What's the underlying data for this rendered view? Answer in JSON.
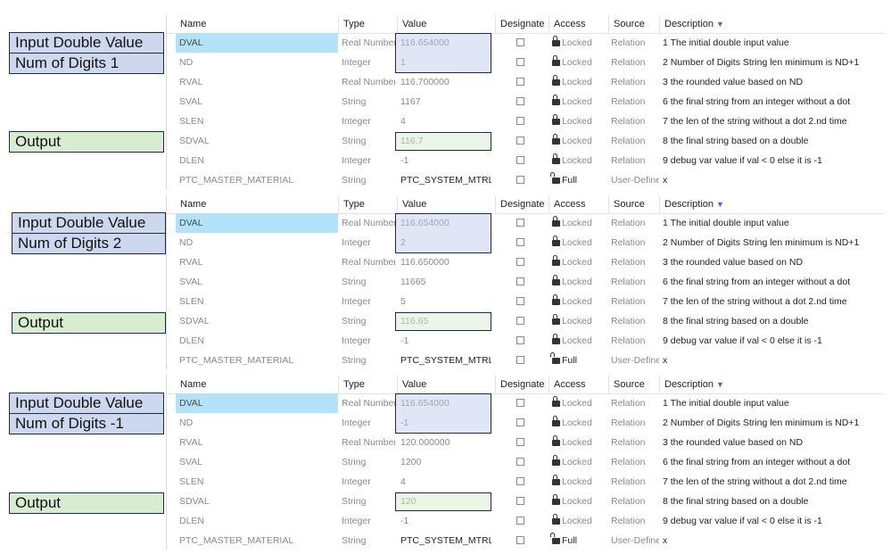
{
  "columns": {
    "name": "Name",
    "type": "Type",
    "value": "Value",
    "designate": "Designate",
    "access": "Access",
    "source": "Source",
    "description": "Description"
  },
  "labels": {
    "input_double_value": "Input Double Value",
    "output": "Output",
    "num_digits_1": "Num of Digits 1",
    "num_digits_2": "Num of Digits 2",
    "num_digits_m1": "Num of Digits -1"
  },
  "access": {
    "locked": "Locked",
    "full": "Full"
  },
  "panels": [
    {
      "rows": [
        {
          "name": "DVAL",
          "type": "Real Number",
          "value": "116.654000",
          "source": "Relation",
          "desc": "1 The initial double input value"
        },
        {
          "name": "ND",
          "type": "Integer",
          "value": "1",
          "source": "Relation",
          "desc": "2 Number of Digits String len minimum is ND+1"
        },
        {
          "name": "RVAL",
          "type": "Real Number",
          "value": "116.700000",
          "source": "Relation",
          "desc": "3 the rounded value based on ND"
        },
        {
          "name": "SVAL",
          "type": "String",
          "value": "1167",
          "source": "Relation",
          "desc": "6 the final string from an integer without a dot"
        },
        {
          "name": "SLEN",
          "type": "Integer",
          "value": "4",
          "source": "Relation",
          "desc": "7 the len of the string without a dot 2.nd time"
        },
        {
          "name": "SDVAL",
          "type": "String",
          "value": "116.7",
          "source": "Relation",
          "desc": "8 the final string based on a double"
        },
        {
          "name": "DLEN",
          "type": "Integer",
          "value": "-1",
          "source": "Relation",
          "desc": "9 debug var value if val < 0 else it is -1"
        },
        {
          "name": "PTC_MASTER_MATERIAL",
          "type": "String",
          "value": "PTC_SYSTEM_MTRL_PF",
          "source": "User-Define",
          "desc": "x"
        }
      ]
    },
    {
      "rows": [
        {
          "name": "DVAL",
          "type": "Real Number",
          "value": "116.654000",
          "source": "Relation",
          "desc": "1 The initial double input value"
        },
        {
          "name": "ND",
          "type": "Integer",
          "value": "2",
          "source": "Relation",
          "desc": "2 Number of Digits String len minimum is ND+1"
        },
        {
          "name": "RVAL",
          "type": "Real Number",
          "value": "116.650000",
          "source": "Relation",
          "desc": "3 the rounded value based on ND"
        },
        {
          "name": "SVAL",
          "type": "String",
          "value": "11665",
          "source": "Relation",
          "desc": "6 the final string from an integer without a dot"
        },
        {
          "name": "SLEN",
          "type": "Integer",
          "value": "5",
          "source": "Relation",
          "desc": "7 the len of the string without a dot 2.nd time"
        },
        {
          "name": "SDVAL",
          "type": "String",
          "value": "116.65",
          "source": "Relation",
          "desc": "8 the final string based on a double"
        },
        {
          "name": "DLEN",
          "type": "Integer",
          "value": "-1",
          "source": "Relation",
          "desc": "9 debug var value if val < 0 else it is -1"
        },
        {
          "name": "PTC_MASTER_MATERIAL",
          "type": "String",
          "value": "PTC_SYSTEM_MTRL_PF",
          "source": "User-Define",
          "desc": "x"
        }
      ]
    },
    {
      "rows": [
        {
          "name": "DVAL",
          "type": "Real Number",
          "value": "116.654000",
          "source": "Relation",
          "desc": "1 The initial double input value"
        },
        {
          "name": "ND",
          "type": "Integer",
          "value": "-1",
          "source": "Relation",
          "desc": "2 Number of Digits String len minimum is ND+1"
        },
        {
          "name": "RVAL",
          "type": "Real Number",
          "value": "120.000000",
          "source": "Relation",
          "desc": "3 the rounded value based on ND"
        },
        {
          "name": "SVAL",
          "type": "String",
          "value": "1200",
          "source": "Relation",
          "desc": "6 the final string from an integer without a dot"
        },
        {
          "name": "SLEN",
          "type": "Integer",
          "value": "4",
          "source": "Relation",
          "desc": "7 the len of the string without a dot 2.nd time"
        },
        {
          "name": "SDVAL",
          "type": "String",
          "value": "120",
          "source": "Relation",
          "desc": "8 the final string based on a double"
        },
        {
          "name": "DLEN",
          "type": "Integer",
          "value": "-1",
          "source": "Relation",
          "desc": "9 debug var value if val < 0 else it is -1"
        },
        {
          "name": "PTC_MASTER_MATERIAL",
          "type": "String",
          "value": "PTC_SYSTEM_MTRL_PF",
          "source": "User-Define",
          "desc": "x"
        }
      ]
    }
  ]
}
